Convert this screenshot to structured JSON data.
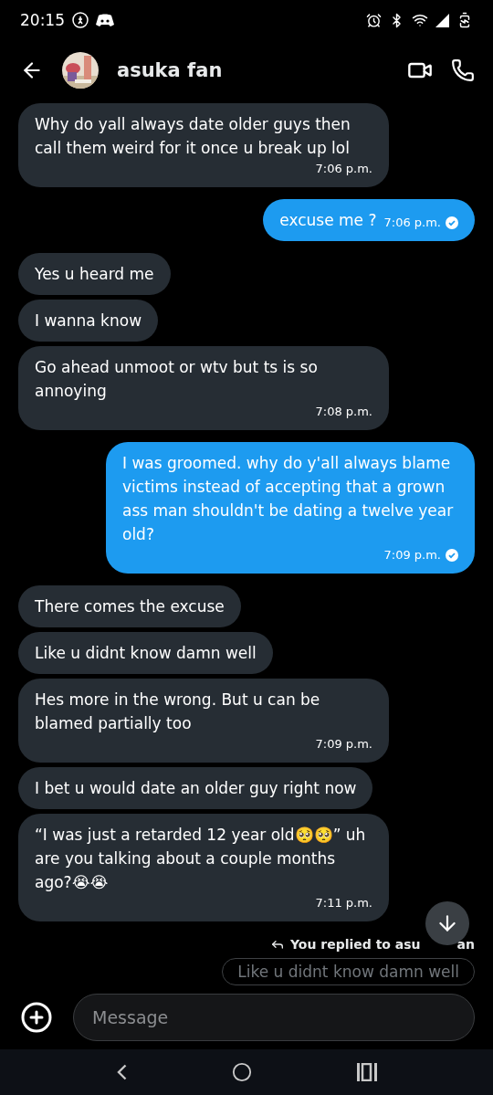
{
  "status_bar": {
    "time": "20:15"
  },
  "header": {
    "contact_name": "asuka fan"
  },
  "messages": [
    {
      "sent": false,
      "text": "Why do yall always date older guys then call them weird for it once u break up lol",
      "time": "7:06 p.m."
    },
    {
      "sent": true,
      "text": "excuse me ?",
      "time": "7:06 p.m.",
      "read": true
    },
    {
      "sent": false,
      "text": "Yes u heard me"
    },
    {
      "sent": false,
      "text": "I wanna know"
    },
    {
      "sent": false,
      "text": "Go ahead unmoot or wtv but ts is so annoying",
      "time": "7:08 p.m."
    },
    {
      "sent": true,
      "text": "I was groomed. why do y'all always blame victims instead of accepting that a grown ass man shouldn't be dating a twelve year old?",
      "time": "7:09 p.m.",
      "read": true
    },
    {
      "sent": false,
      "text": "There comes the excuse"
    },
    {
      "sent": false,
      "text": "Like u didnt know damn well"
    },
    {
      "sent": false,
      "text": "Hes more in the wrong. But u can be blamed partially too",
      "time": "7:09 p.m."
    },
    {
      "sent": false,
      "text": "I bet u would date an older guy right now"
    },
    {
      "sent": false,
      "text": "“I was just a retarded 12 year old🥺🥺” uh are you talking about a couple months ago?😭😭",
      "time": "7:11 p.m."
    }
  ],
  "reply_preview": {
    "label_start": "You replied to asu",
    "label_end": "an",
    "quoted": "Like u didnt know damn well"
  },
  "composer": {
    "placeholder": "Message"
  }
}
